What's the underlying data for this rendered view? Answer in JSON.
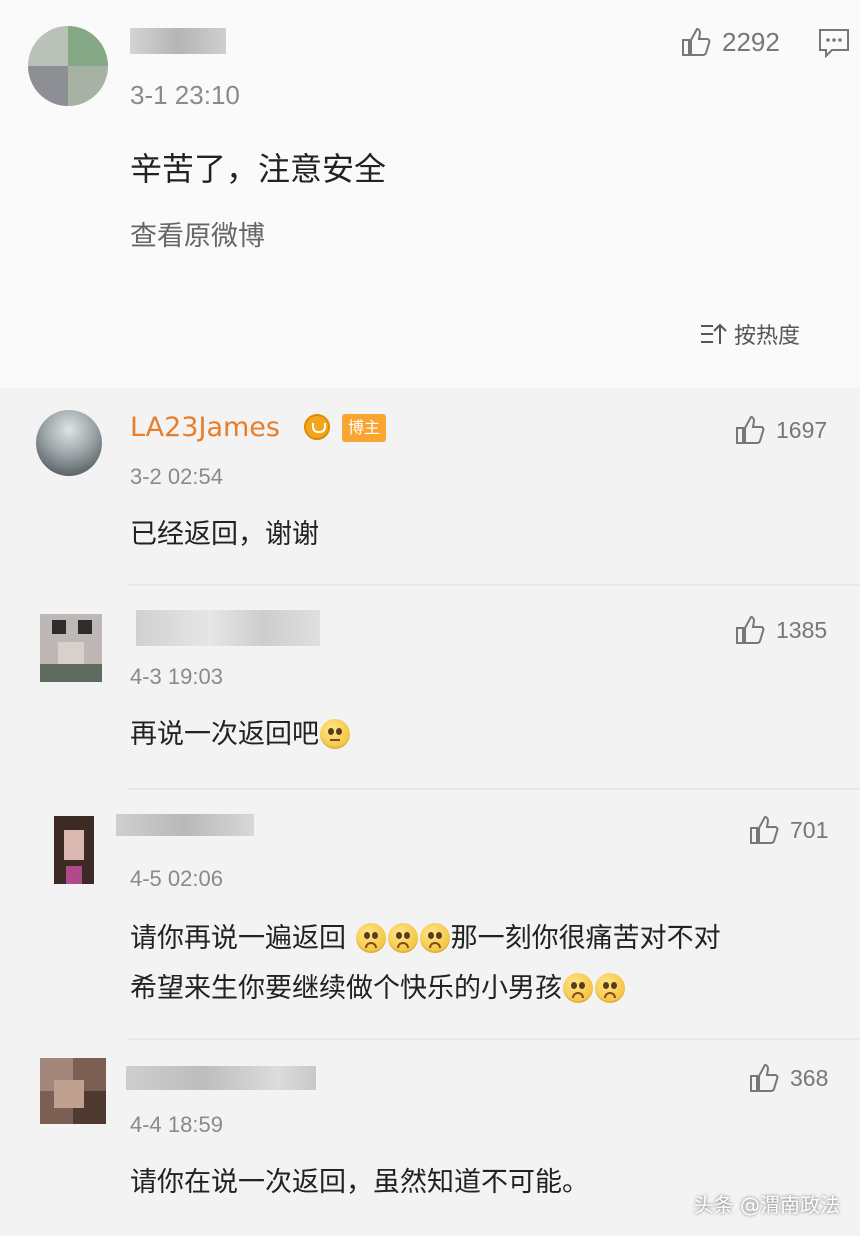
{
  "main_comment": {
    "time": "3-1 23:10",
    "likes": "2292",
    "text": "辛苦了，注意安全",
    "view_original": "查看原微博"
  },
  "sort_label": "按热度",
  "replies": [
    {
      "username": "LA23James",
      "host_badge": "博主",
      "time": "3-2 02:54",
      "likes": "1697",
      "text": "已经返回，谢谢"
    },
    {
      "time": "4-3 19:03",
      "likes": "1385",
      "text": "再说一次返回吧"
    },
    {
      "time": "4-5 02:06",
      "likes": "701",
      "text_line1_a": "请你再说一遍返回",
      "text_line1_b": "那一刻你很痛苦对不对",
      "text_line2": "希望来生你要继续做个快乐的小男孩"
    },
    {
      "time": "4-4 18:59",
      "likes": "368",
      "text": "请你在说一次返回，虽然知道不可能。"
    }
  ],
  "watermark": "头条 @渭南政法",
  "icons": {
    "like": "thumbs-up-icon",
    "comment": "comment-icon",
    "sort": "sort-icon",
    "emoji_sad": "sad-face-emoji",
    "emoji_flat": "speechless-face-emoji"
  }
}
